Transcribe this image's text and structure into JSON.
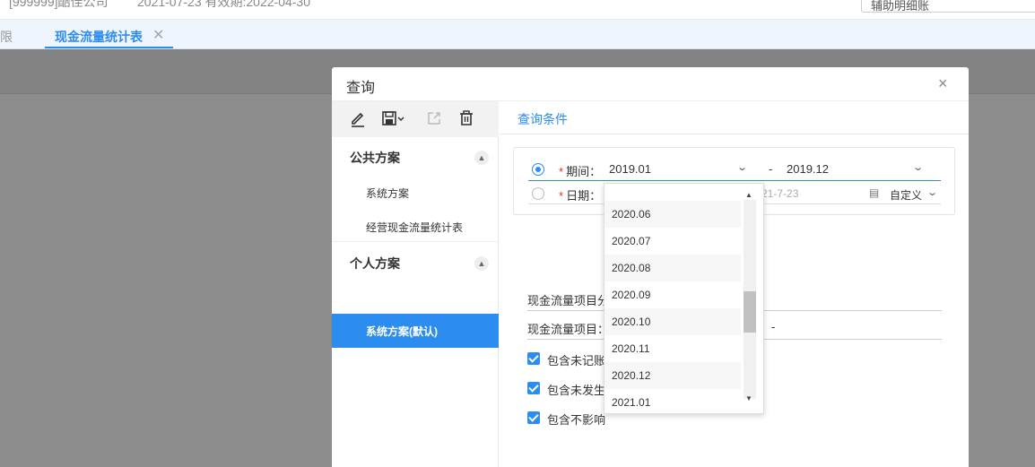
{
  "header": {
    "company": "[999999]酷佳公司",
    "date_info": "2021-07-23   有效期:2022-04-30",
    "search_value": "辅助明细账"
  },
  "tabs": {
    "prev_label": "限",
    "active_label": "现金流量统计表",
    "close_glyph": "✕"
  },
  "modal": {
    "title": "查询",
    "close_glyph": "×",
    "toolbar": [
      "edit-icon",
      "save-icon",
      "share-icon",
      "trash-icon"
    ],
    "public_group": {
      "title": "公共方案",
      "items": [
        "系统方案",
        "经营现金流量统计表"
      ]
    },
    "personal_group": {
      "title": "个人方案",
      "items": [
        "系统方案(默认)"
      ]
    },
    "right_tab": "查询条件",
    "period": {
      "label": "期间：",
      "from": "2019.01",
      "separator": "-",
      "to": "2019.12"
    },
    "date": {
      "label": "日期：",
      "partial_value": "21-7-23",
      "custom_label": "自定义"
    },
    "fields": [
      {
        "label": "现金流量项目分"
      },
      {
        "label": "现金流量项目：",
        "separator": "-"
      }
    ],
    "checkboxes": [
      "包含未记账",
      "包含未发生",
      "包含不影响"
    ]
  },
  "dropdown": {
    "options": [
      "2020.06",
      "2020.07",
      "2020.08",
      "2020.09",
      "2020.10",
      "2020.11",
      "2020.12",
      "2021.01"
    ]
  },
  "colors": {
    "accent": "#2d8cf0",
    "overlay": "#8c8c8c",
    "required": "#e33333"
  }
}
